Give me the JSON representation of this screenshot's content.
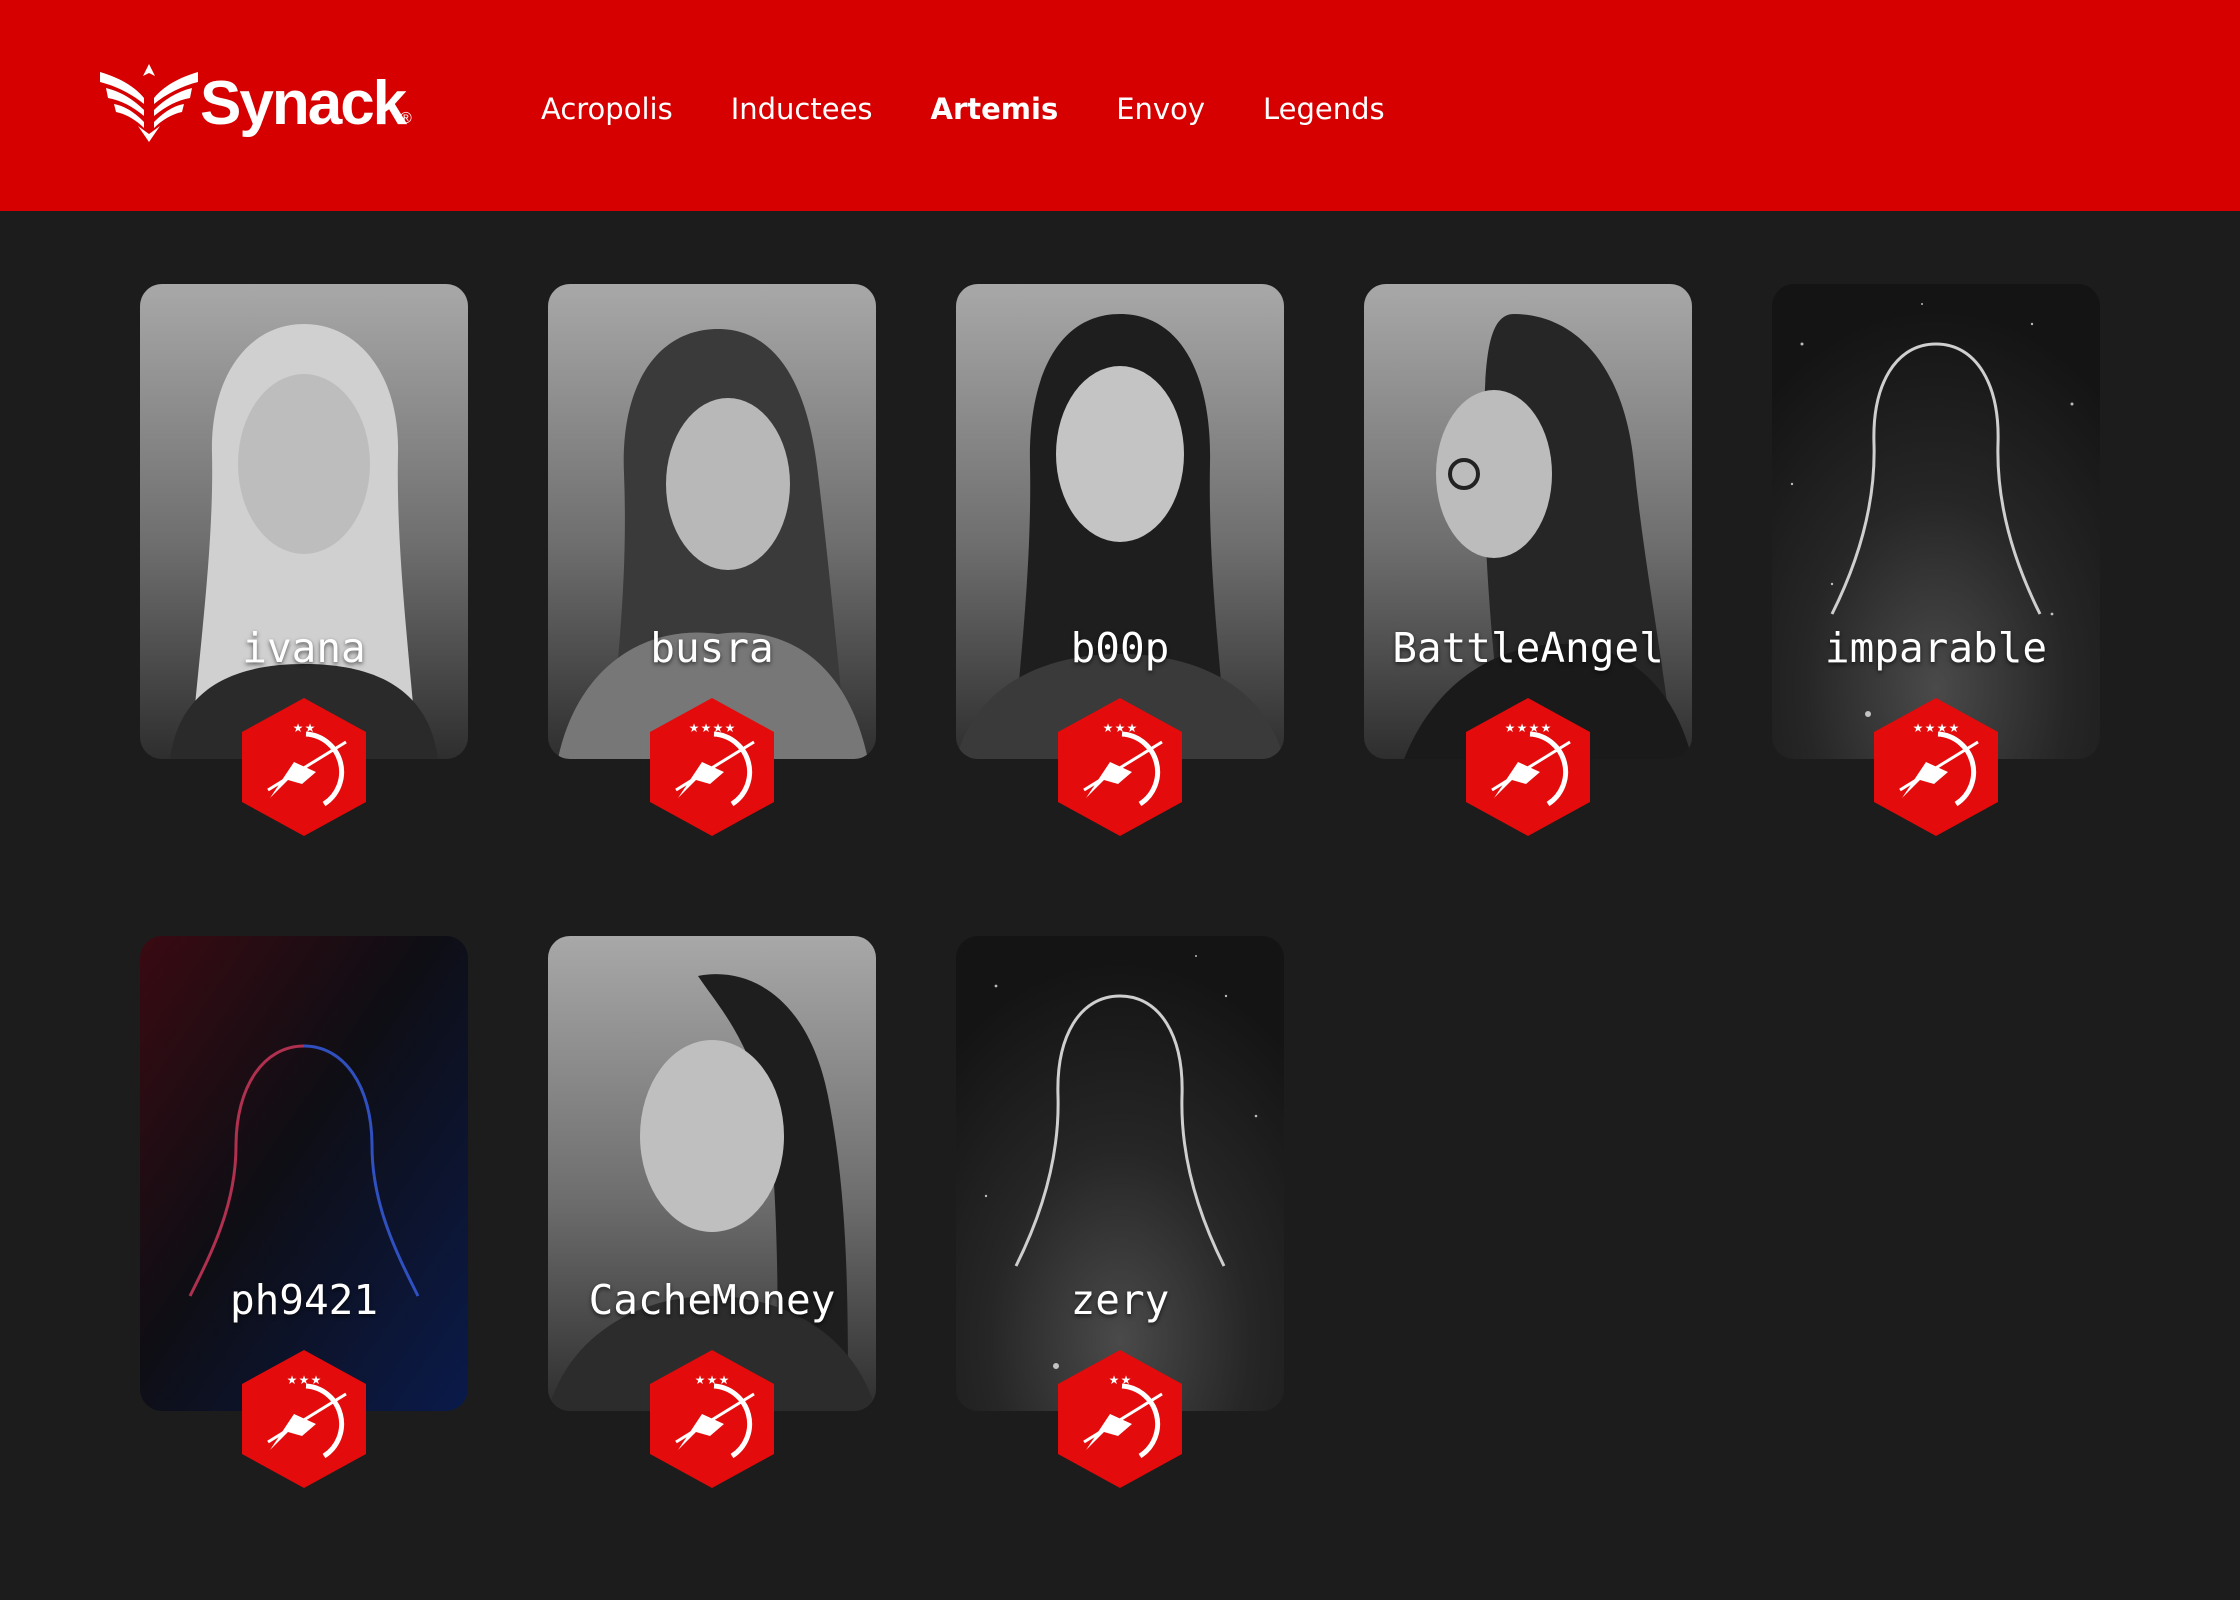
{
  "brand": {
    "name": "Synack",
    "registered_mark": "®",
    "logo_icon": "eagle-wings-icon",
    "brand_color": "#d60000"
  },
  "nav": {
    "items": [
      {
        "label": "Acropolis",
        "active": false
      },
      {
        "label": "Inductees",
        "active": false
      },
      {
        "label": "Artemis",
        "active": true
      },
      {
        "label": "Envoy",
        "active": false
      },
      {
        "label": "Legends",
        "active": false
      }
    ]
  },
  "members": [
    {
      "handle": "ivana",
      "photo": "portrait-photo",
      "stars": 2
    },
    {
      "handle": "busra",
      "photo": "portrait-photo",
      "stars": 4
    },
    {
      "handle": "b00p",
      "photo": "portrait-photo",
      "stars": 3
    },
    {
      "handle": "BattleAngel",
      "photo": "portrait-photo",
      "stars": 4
    },
    {
      "handle": "imparable",
      "photo": "silhouette-placeholder",
      "stars": 4
    },
    {
      "handle": "ph9421",
      "photo": "silhouette-placeholder-redblue",
      "stars": 3
    },
    {
      "handle": "CacheMoney",
      "photo": "portrait-photo",
      "stars": 3
    },
    {
      "handle": "zery",
      "photo": "silhouette-placeholder",
      "stars": 2
    }
  ],
  "colors": {
    "background": "#1c1c1c",
    "badge_red": "#e30b0b",
    "text": "#ffffff"
  }
}
